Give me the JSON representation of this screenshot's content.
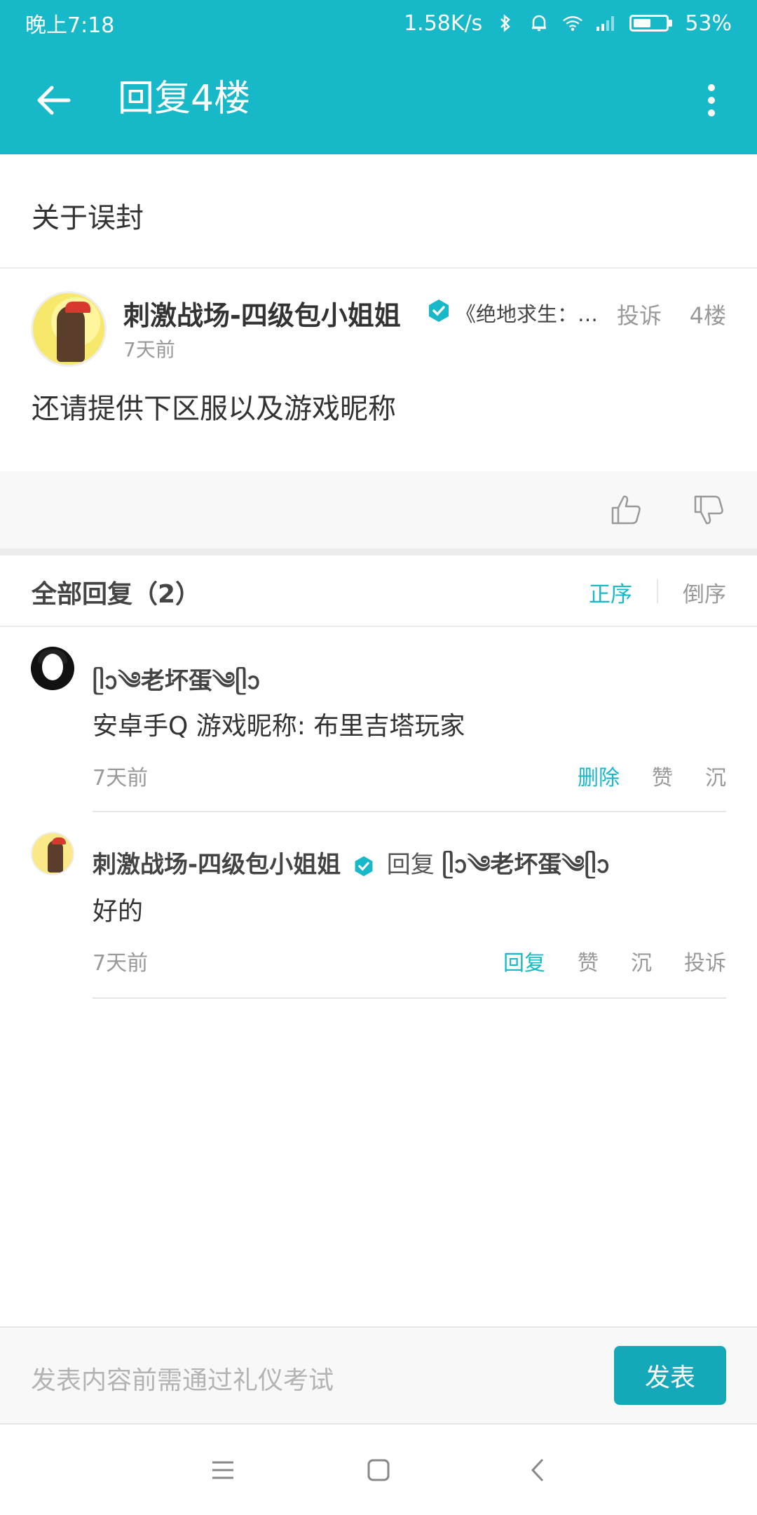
{
  "status_bar": {
    "time": "晚上7:18",
    "network_speed": "1.58K/s",
    "battery": "53%",
    "battery_level": 0.53,
    "icons": [
      "bluetooth-icon",
      "alarm-icon",
      "wifi-icon",
      "signal-icon",
      "battery-icon"
    ]
  },
  "app_bar": {
    "title": "回复4楼",
    "back_icon": "arrow-left-icon",
    "more_icon": "more-vertical-icon"
  },
  "subject": "关于误封",
  "post": {
    "author": "刺激战场-四级包小姐姐",
    "game_tag": "《绝地求生：刺激战场》",
    "report": "投诉",
    "floor": "4楼",
    "time": "7天前",
    "content": "还请提供下区服以及游戏昵称"
  },
  "replies_header": {
    "label": "全部回复（2）",
    "sort_asc": "正序",
    "sort_desc": "倒序"
  },
  "replies": [
    {
      "author": "ᥫᩣ༄老坏蛋༄ᥫᩣ",
      "content": "安卓手Q 游戏昵称: 布里吉塔玩家",
      "time": "7天前",
      "actions": [
        "删除",
        "赞",
        "沉"
      ]
    },
    {
      "author": "刺激战场-四级包小姐姐",
      "reply_word": "回复",
      "reply_to": "ᥫᩣ༄老坏蛋༄ᥫᩣ",
      "content": "好的",
      "time": "7天前",
      "actions": [
        "回复",
        "赞",
        "沉",
        "投诉"
      ]
    }
  ],
  "composer": {
    "placeholder": "发表内容前需通过礼仪考试",
    "publish": "发表"
  },
  "colors": {
    "accent": "#17b8c8",
    "button": "#15a8b8",
    "muted_text": "#999999"
  }
}
